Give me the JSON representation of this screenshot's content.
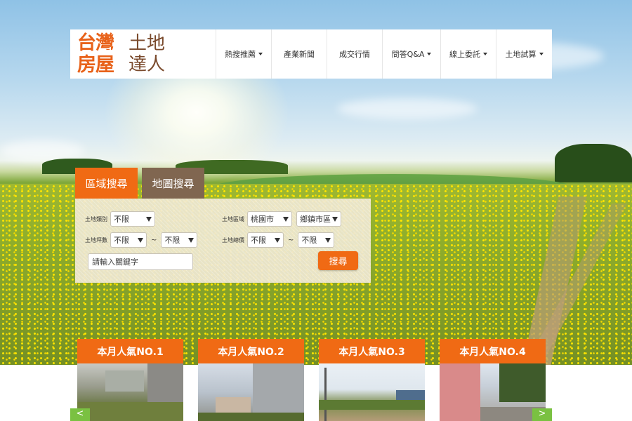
{
  "logo": {
    "line1": "台灣",
    "line2": "房屋",
    "line3": "土地",
    "line4": "達人"
  },
  "nav": [
    {
      "label": "熱搜推薦",
      "dropdown": true
    },
    {
      "label": "產業新聞",
      "dropdown": false
    },
    {
      "label": "成交行情",
      "dropdown": false
    },
    {
      "label": "問答Q&A",
      "dropdown": true
    },
    {
      "label": "線上委託",
      "dropdown": true
    },
    {
      "label": "土地試算",
      "dropdown": true
    }
  ],
  "tabs": {
    "area_search": "區域搜尋",
    "map_search": "地圖搜尋"
  },
  "search": {
    "land_type_label": "土地類別",
    "land_type_value": "不限",
    "land_area_label": "土地區域",
    "city_value": "桃園市",
    "district_value": "鄉鎮市區",
    "size_label": "土地坪數",
    "size_min": "不限",
    "size_max": "不限",
    "price_label": "土地總價",
    "price_min": "不限",
    "price_max": "不限",
    "range_sep": "~",
    "keyword_placeholder": "請輸入關鍵字",
    "submit_label": "搜尋"
  },
  "popular": [
    {
      "title": "本月人氣NO.1"
    },
    {
      "title": "本月人氣NO.2"
    },
    {
      "title": "本月人氣NO.3"
    },
    {
      "title": "本月人氣NO.4"
    }
  ],
  "carousel": {
    "prev": "<",
    "next": ">"
  },
  "colors": {
    "accent": "#f06a14",
    "tab_inactive": "#806650",
    "carousel_arrow": "#7ac142"
  }
}
